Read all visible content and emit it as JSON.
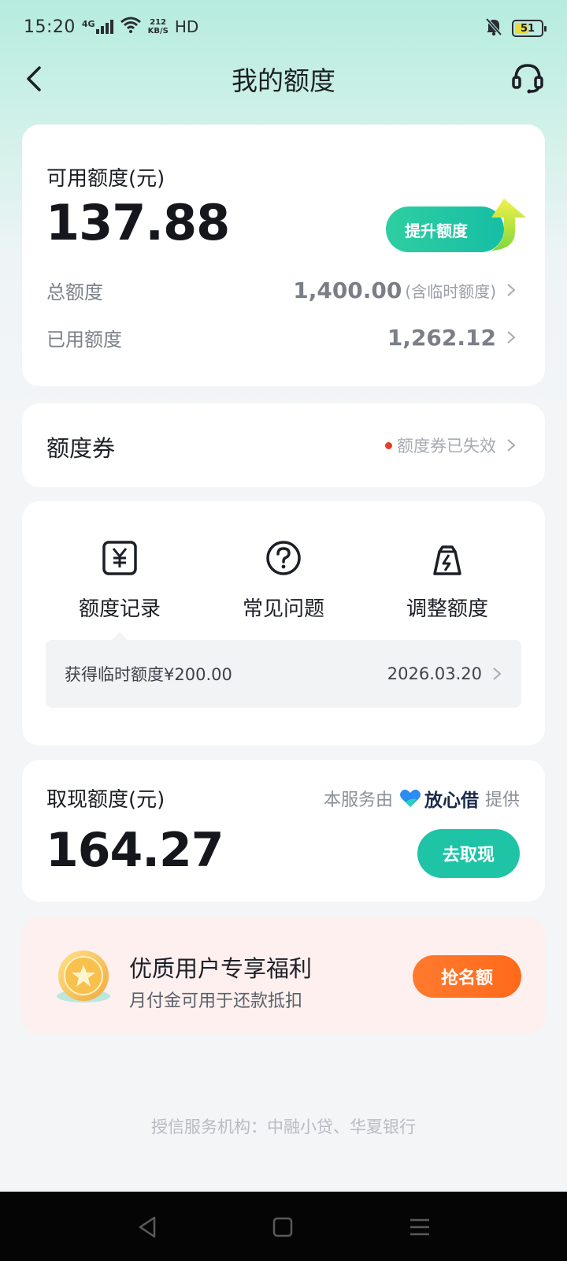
{
  "status_bar": {
    "time": "15:20",
    "network": "4G",
    "speed_value": "212",
    "speed_unit": "KB/S",
    "hd": "HD",
    "battery": "51",
    "battery_level_percent": 51,
    "icons": [
      "signal-icon",
      "wifi-icon",
      "mute-bell-icon",
      "battery-icon"
    ]
  },
  "header": {
    "title": "我的额度",
    "back_icon": "back-arrow-icon",
    "service_icon": "headset-icon"
  },
  "quota_card": {
    "available_label": "可用额度(元)",
    "available_amount": "137.88",
    "raise_button": "提升额度",
    "total_label": "总额度",
    "total_value": "1,400.00",
    "total_note": "(含临时额度)",
    "used_label": "已用额度",
    "used_value": "1,262.12"
  },
  "coupon_card": {
    "title": "额度券",
    "status": "额度券已失效"
  },
  "tools": {
    "items": [
      {
        "label": "额度记录",
        "icon": "yuan-receipt-icon"
      },
      {
        "label": "常见问题",
        "icon": "question-circle-icon"
      },
      {
        "label": "调整额度",
        "icon": "lightning-bag-icon"
      }
    ],
    "tip_text": "获得临时额度¥200.00",
    "tip_date": "2026.03.20"
  },
  "cash_card": {
    "label": "取现额度(元)",
    "provider_prefix": "本服务由",
    "provider_brand": "放心借",
    "provider_suffix": "提供",
    "amount": "164.27",
    "button": "去取现"
  },
  "benefit_card": {
    "title": "优质用户专享福利",
    "subtitle": "月付金可用于还款抵扣",
    "button": "抢名额"
  },
  "footer": {
    "text": "授信服务机构：中融小贷、华夏银行"
  },
  "colors": {
    "accent_green": "#1fc4a6",
    "accent_orange": "#ff6a1a",
    "header_bg": "#b6ecdf",
    "benefit_bg": "#fdf0ef"
  }
}
